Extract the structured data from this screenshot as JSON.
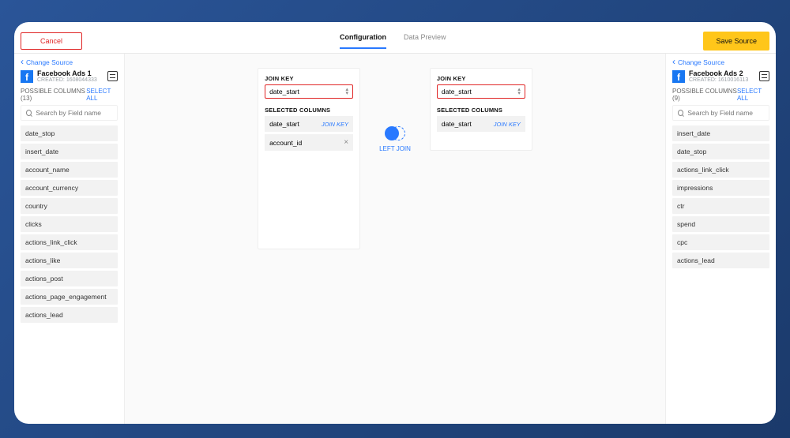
{
  "header": {
    "cancel_label": "Cancel",
    "save_label": "Save Source",
    "tabs": {
      "config": "Configuration",
      "preview": "Data Preview"
    }
  },
  "left_source": {
    "change_label": "Change Source",
    "name": "Facebook Ads 1",
    "created_line": "CREATED: 1608044333",
    "possible_cols_label": "POSSIBLE COLUMNS (13)",
    "select_all_label": "SELECT ALL",
    "search_placeholder": "Search by Field name",
    "columns": [
      "date_stop",
      "insert_date",
      "account_name",
      "account_currency",
      "country",
      "clicks",
      "actions_link_click",
      "actions_like",
      "actions_post",
      "actions_page_engagement",
      "actions_lead"
    ]
  },
  "right_source": {
    "change_label": "Change Source",
    "name": "Facebook Ads 2",
    "created_line": "CREATED: 1610016113",
    "possible_cols_label": "POSSIBLE COLUMNS (9)",
    "select_all_label": "SELECT ALL",
    "search_placeholder": "Search by Field name",
    "columns": [
      "insert_date",
      "date_stop",
      "actions_link_click",
      "impressions",
      "ctr",
      "spend",
      "cpc",
      "actions_lead"
    ]
  },
  "join": {
    "left_card": {
      "key_label": "JOIN KEY",
      "key_value": "date_start",
      "selected_label": "SELECTED COLUMNS",
      "rows": [
        {
          "name": "date_start",
          "tag": "JOIN KEY"
        },
        {
          "name": "account_id",
          "removable": true
        }
      ]
    },
    "right_card": {
      "key_label": "JOIN KEY",
      "key_value": "date_start",
      "selected_label": "SELECTED COLUMNS",
      "rows": [
        {
          "name": "date_start",
          "tag": "JOIN KEY"
        }
      ]
    },
    "type_label": "LEFT JOIN"
  }
}
